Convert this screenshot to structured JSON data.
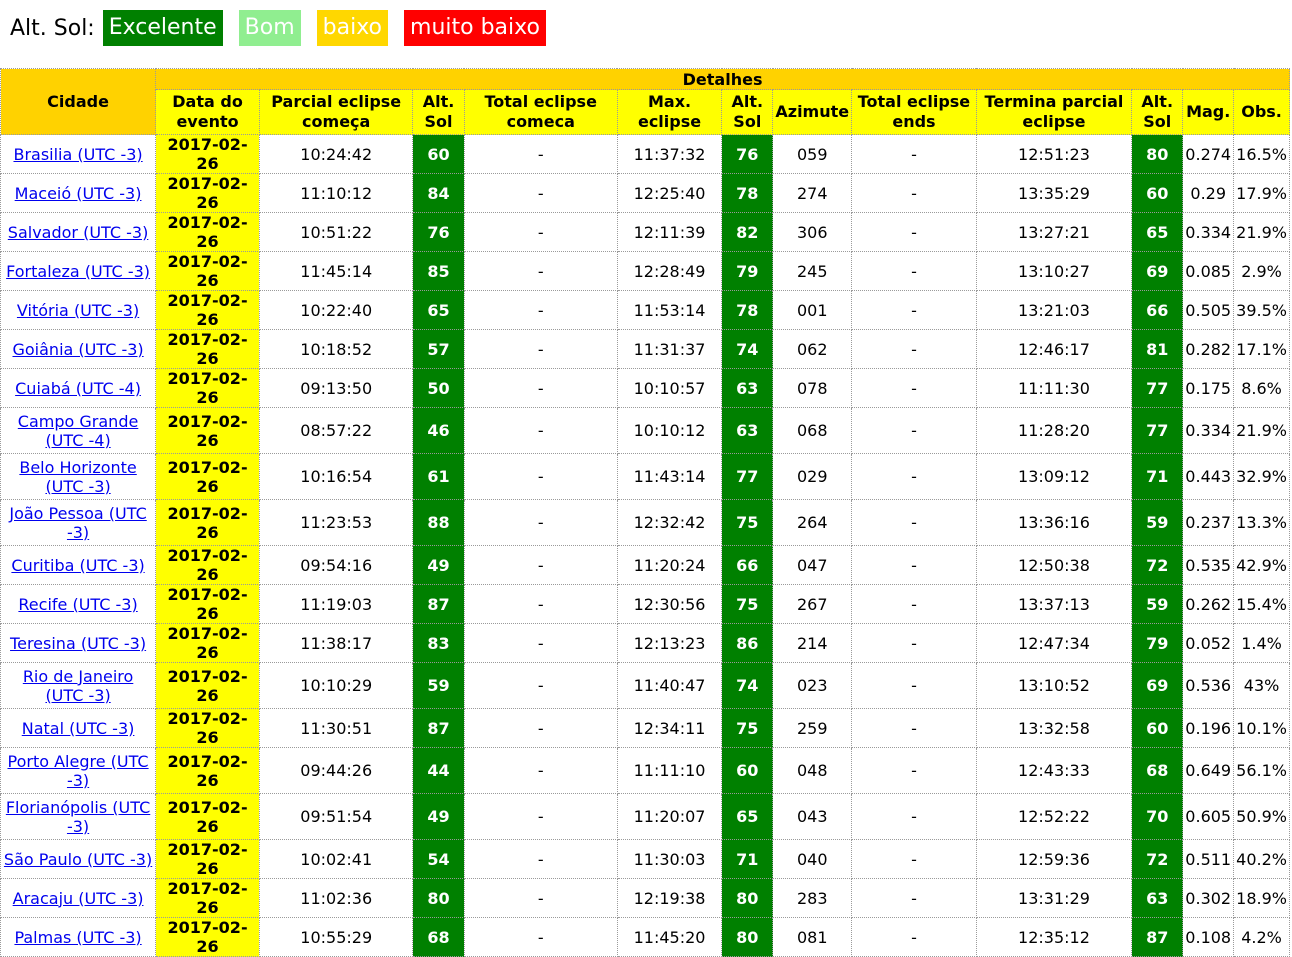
{
  "legend": {
    "label": "Alt. Sol:",
    "items": [
      {
        "text": "Excelente",
        "bg": "#008000",
        "fg": "#ffffff"
      },
      {
        "text": "Bom",
        "bg": "#90ee90",
        "fg": "#ffffff"
      },
      {
        "text": "baixo",
        "bg": "#ffd700",
        "fg": "#ffffff"
      },
      {
        "text": "muito baixo",
        "bg": "#ff0000",
        "fg": "#ffffff"
      }
    ]
  },
  "table": {
    "detalhes": "Detalhes",
    "cidade": "Cidade",
    "headers": {
      "data": "Data do evento",
      "parcial_comeca": "Parcial eclipse começa",
      "alt1": "Alt. Sol",
      "total_comeca": "Total eclipse comeca",
      "max": "Max. eclipse",
      "alt2": "Alt. Sol",
      "azimute": "Azimute",
      "total_ends": "Total eclipse ends",
      "termina": "Termina parcial eclipse",
      "alt3": "Alt. Sol",
      "mag": "Mag.",
      "obs": "Obs."
    },
    "rows": [
      {
        "city": "Brasilia (UTC -3)",
        "date": "2017-02-26",
        "start": "10:24:42",
        "alt1": "60",
        "total": "-",
        "max": "11:37:32",
        "alt2": "76",
        "az": "059",
        "tend": "-",
        "end": "12:51:23",
        "alt3": "80",
        "mag": "0.274",
        "obs": "16.5%",
        "tall": false
      },
      {
        "city": "Maceió (UTC -3)",
        "date": "2017-02-26",
        "start": "11:10:12",
        "alt1": "84",
        "total": "-",
        "max": "12:25:40",
        "alt2": "78",
        "az": "274",
        "tend": "-",
        "end": "13:35:29",
        "alt3": "60",
        "mag": "0.29",
        "obs": "17.9%",
        "tall": false
      },
      {
        "city": "Salvador (UTC -3)",
        "date": "2017-02-26",
        "start": "10:51:22",
        "alt1": "76",
        "total": "-",
        "max": "12:11:39",
        "alt2": "82",
        "az": "306",
        "tend": "-",
        "end": "13:27:21",
        "alt3": "65",
        "mag": "0.334",
        "obs": "21.9%",
        "tall": false
      },
      {
        "city": "Fortaleza (UTC -3)",
        "date": "2017-02-26",
        "start": "11:45:14",
        "alt1": "85",
        "total": "-",
        "max": "12:28:49",
        "alt2": "79",
        "az": "245",
        "tend": "-",
        "end": "13:10:27",
        "alt3": "69",
        "mag": "0.085",
        "obs": "2.9%",
        "tall": false
      },
      {
        "city": "Vitória (UTC -3)",
        "date": "2017-02-26",
        "start": "10:22:40",
        "alt1": "65",
        "total": "-",
        "max": "11:53:14",
        "alt2": "78",
        "az": "001",
        "tend": "-",
        "end": "13:21:03",
        "alt3": "66",
        "mag": "0.505",
        "obs": "39.5%",
        "tall": false
      },
      {
        "city": "Goiânia (UTC -3)",
        "date": "2017-02-26",
        "start": "10:18:52",
        "alt1": "57",
        "total": "-",
        "max": "11:31:37",
        "alt2": "74",
        "az": "062",
        "tend": "-",
        "end": "12:46:17",
        "alt3": "81",
        "mag": "0.282",
        "obs": "17.1%",
        "tall": false
      },
      {
        "city": "Cuiabá (UTC -4)",
        "date": "2017-02-26",
        "start": "09:13:50",
        "alt1": "50",
        "total": "-",
        "max": "10:10:57",
        "alt2": "63",
        "az": "078",
        "tend": "-",
        "end": "11:11:30",
        "alt3": "77",
        "mag": "0.175",
        "obs": "8.6%",
        "tall": false
      },
      {
        "city": "Campo Grande (UTC -4)",
        "date": "2017-02-26",
        "start": "08:57:22",
        "alt1": "46",
        "total": "-",
        "max": "10:10:12",
        "alt2": "63",
        "az": "068",
        "tend": "-",
        "end": "11:28:20",
        "alt3": "77",
        "mag": "0.334",
        "obs": "21.9%",
        "tall": true
      },
      {
        "city": "Belo Horizonte (UTC -3)",
        "date": "2017-02-26",
        "start": "10:16:54",
        "alt1": "61",
        "total": "-",
        "max": "11:43:14",
        "alt2": "77",
        "az": "029",
        "tend": "-",
        "end": "13:09:12",
        "alt3": "71",
        "mag": "0.443",
        "obs": "32.9%",
        "tall": true
      },
      {
        "city": "João Pessoa (UTC -3)",
        "date": "2017-02-26",
        "start": "11:23:53",
        "alt1": "88",
        "total": "-",
        "max": "12:32:42",
        "alt2": "75",
        "az": "264",
        "tend": "-",
        "end": "13:36:16",
        "alt3": "59",
        "mag": "0.237",
        "obs": "13.3%",
        "tall": true
      },
      {
        "city": "Curitiba (UTC -3)",
        "date": "2017-02-26",
        "start": "09:54:16",
        "alt1": "49",
        "total": "-",
        "max": "11:20:24",
        "alt2": "66",
        "az": "047",
        "tend": "-",
        "end": "12:50:38",
        "alt3": "72",
        "mag": "0.535",
        "obs": "42.9%",
        "tall": false
      },
      {
        "city": "Recife (UTC -3)",
        "date": "2017-02-26",
        "start": "11:19:03",
        "alt1": "87",
        "total": "-",
        "max": "12:30:56",
        "alt2": "75",
        "az": "267",
        "tend": "-",
        "end": "13:37:13",
        "alt3": "59",
        "mag": "0.262",
        "obs": "15.4%",
        "tall": false
      },
      {
        "city": "Teresina (UTC -3)",
        "date": "2017-02-26",
        "start": "11:38:17",
        "alt1": "83",
        "total": "-",
        "max": "12:13:23",
        "alt2": "86",
        "az": "214",
        "tend": "-",
        "end": "12:47:34",
        "alt3": "79",
        "mag": "0.052",
        "obs": "1.4%",
        "tall": false
      },
      {
        "city": "Rio de Janeiro (UTC -3)",
        "date": "2017-02-26",
        "start": "10:10:29",
        "alt1": "59",
        "total": "-",
        "max": "11:40:47",
        "alt2": "74",
        "az": "023",
        "tend": "-",
        "end": "13:10:52",
        "alt3": "69",
        "mag": "0.536",
        "obs": "43%",
        "tall": true
      },
      {
        "city": "Natal (UTC -3)",
        "date": "2017-02-26",
        "start": "11:30:51",
        "alt1": "87",
        "total": "-",
        "max": "12:34:11",
        "alt2": "75",
        "az": "259",
        "tend": "-",
        "end": "13:32:58",
        "alt3": "60",
        "mag": "0.196",
        "obs": "10.1%",
        "tall": false
      },
      {
        "city": "Porto Alegre (UTC -3)",
        "date": "2017-02-26",
        "start": "09:44:26",
        "alt1": "44",
        "total": "-",
        "max": "11:11:10",
        "alt2": "60",
        "az": "048",
        "tend": "-",
        "end": "12:43:33",
        "alt3": "68",
        "mag": "0.649",
        "obs": "56.1%",
        "tall": true
      },
      {
        "city": "Florianópolis (UTC -3)",
        "date": "2017-02-26",
        "start": "09:51:54",
        "alt1": "49",
        "total": "-",
        "max": "11:20:07",
        "alt2": "65",
        "az": "043",
        "tend": "-",
        "end": "12:52:22",
        "alt3": "70",
        "mag": "0.605",
        "obs": "50.9%",
        "tall": true
      },
      {
        "city": "São Paulo (UTC -3)",
        "date": "2017-02-26",
        "start": "10:02:41",
        "alt1": "54",
        "total": "-",
        "max": "11:30:03",
        "alt2": "71",
        "az": "040",
        "tend": "-",
        "end": "12:59:36",
        "alt3": "72",
        "mag": "0.511",
        "obs": "40.2%",
        "tall": false
      },
      {
        "city": "Aracaju (UTC -3)",
        "date": "2017-02-26",
        "start": "11:02:36",
        "alt1": "80",
        "total": "-",
        "max": "12:19:38",
        "alt2": "80",
        "az": "283",
        "tend": "-",
        "end": "13:31:29",
        "alt3": "63",
        "mag": "0.302",
        "obs": "18.9%",
        "tall": false
      },
      {
        "city": "Palmas (UTC -3)",
        "date": "2017-02-26",
        "start": "10:55:29",
        "alt1": "68",
        "total": "-",
        "max": "11:45:20",
        "alt2": "80",
        "az": "081",
        "tend": "-",
        "end": "12:35:12",
        "alt3": "87",
        "mag": "0.108",
        "obs": "4.2%",
        "tall": false
      }
    ]
  }
}
